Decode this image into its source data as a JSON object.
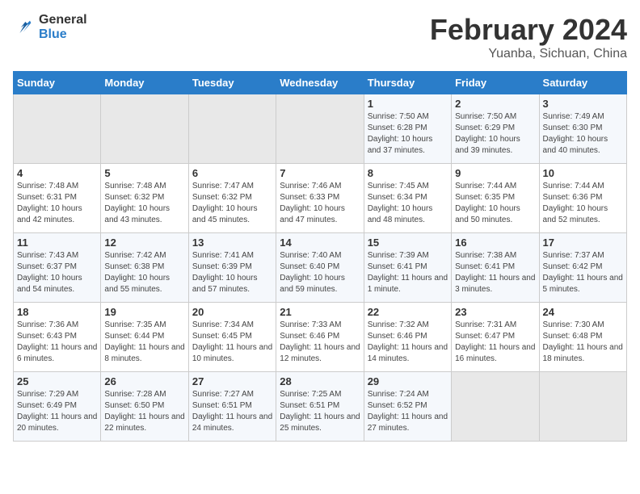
{
  "header": {
    "logo_line1": "General",
    "logo_line2": "Blue",
    "month_title": "February 2024",
    "subtitle": "Yuanba, Sichuan, China"
  },
  "weekdays": [
    "Sunday",
    "Monday",
    "Tuesday",
    "Wednesday",
    "Thursday",
    "Friday",
    "Saturday"
  ],
  "weeks": [
    [
      {
        "day": "",
        "empty": true
      },
      {
        "day": "",
        "empty": true
      },
      {
        "day": "",
        "empty": true
      },
      {
        "day": "",
        "empty": true
      },
      {
        "day": "1",
        "sunrise": "Sunrise: 7:50 AM",
        "sunset": "Sunset: 6:28 PM",
        "daylight": "Daylight: 10 hours and 37 minutes."
      },
      {
        "day": "2",
        "sunrise": "Sunrise: 7:50 AM",
        "sunset": "Sunset: 6:29 PM",
        "daylight": "Daylight: 10 hours and 39 minutes."
      },
      {
        "day": "3",
        "sunrise": "Sunrise: 7:49 AM",
        "sunset": "Sunset: 6:30 PM",
        "daylight": "Daylight: 10 hours and 40 minutes."
      }
    ],
    [
      {
        "day": "4",
        "sunrise": "Sunrise: 7:48 AM",
        "sunset": "Sunset: 6:31 PM",
        "daylight": "Daylight: 10 hours and 42 minutes."
      },
      {
        "day": "5",
        "sunrise": "Sunrise: 7:48 AM",
        "sunset": "Sunset: 6:32 PM",
        "daylight": "Daylight: 10 hours and 43 minutes."
      },
      {
        "day": "6",
        "sunrise": "Sunrise: 7:47 AM",
        "sunset": "Sunset: 6:32 PM",
        "daylight": "Daylight: 10 hours and 45 minutes."
      },
      {
        "day": "7",
        "sunrise": "Sunrise: 7:46 AM",
        "sunset": "Sunset: 6:33 PM",
        "daylight": "Daylight: 10 hours and 47 minutes."
      },
      {
        "day": "8",
        "sunrise": "Sunrise: 7:45 AM",
        "sunset": "Sunset: 6:34 PM",
        "daylight": "Daylight: 10 hours and 48 minutes."
      },
      {
        "day": "9",
        "sunrise": "Sunrise: 7:44 AM",
        "sunset": "Sunset: 6:35 PM",
        "daylight": "Daylight: 10 hours and 50 minutes."
      },
      {
        "day": "10",
        "sunrise": "Sunrise: 7:44 AM",
        "sunset": "Sunset: 6:36 PM",
        "daylight": "Daylight: 10 hours and 52 minutes."
      }
    ],
    [
      {
        "day": "11",
        "sunrise": "Sunrise: 7:43 AM",
        "sunset": "Sunset: 6:37 PM",
        "daylight": "Daylight: 10 hours and 54 minutes."
      },
      {
        "day": "12",
        "sunrise": "Sunrise: 7:42 AM",
        "sunset": "Sunset: 6:38 PM",
        "daylight": "Daylight: 10 hours and 55 minutes."
      },
      {
        "day": "13",
        "sunrise": "Sunrise: 7:41 AM",
        "sunset": "Sunset: 6:39 PM",
        "daylight": "Daylight: 10 hours and 57 minutes."
      },
      {
        "day": "14",
        "sunrise": "Sunrise: 7:40 AM",
        "sunset": "Sunset: 6:40 PM",
        "daylight": "Daylight: 10 hours and 59 minutes."
      },
      {
        "day": "15",
        "sunrise": "Sunrise: 7:39 AM",
        "sunset": "Sunset: 6:41 PM",
        "daylight": "Daylight: 11 hours and 1 minute."
      },
      {
        "day": "16",
        "sunrise": "Sunrise: 7:38 AM",
        "sunset": "Sunset: 6:41 PM",
        "daylight": "Daylight: 11 hours and 3 minutes."
      },
      {
        "day": "17",
        "sunrise": "Sunrise: 7:37 AM",
        "sunset": "Sunset: 6:42 PM",
        "daylight": "Daylight: 11 hours and 5 minutes."
      }
    ],
    [
      {
        "day": "18",
        "sunrise": "Sunrise: 7:36 AM",
        "sunset": "Sunset: 6:43 PM",
        "daylight": "Daylight: 11 hours and 6 minutes."
      },
      {
        "day": "19",
        "sunrise": "Sunrise: 7:35 AM",
        "sunset": "Sunset: 6:44 PM",
        "daylight": "Daylight: 11 hours and 8 minutes."
      },
      {
        "day": "20",
        "sunrise": "Sunrise: 7:34 AM",
        "sunset": "Sunset: 6:45 PM",
        "daylight": "Daylight: 11 hours and 10 minutes."
      },
      {
        "day": "21",
        "sunrise": "Sunrise: 7:33 AM",
        "sunset": "Sunset: 6:46 PM",
        "daylight": "Daylight: 11 hours and 12 minutes."
      },
      {
        "day": "22",
        "sunrise": "Sunrise: 7:32 AM",
        "sunset": "Sunset: 6:46 PM",
        "daylight": "Daylight: 11 hours and 14 minutes."
      },
      {
        "day": "23",
        "sunrise": "Sunrise: 7:31 AM",
        "sunset": "Sunset: 6:47 PM",
        "daylight": "Daylight: 11 hours and 16 minutes."
      },
      {
        "day": "24",
        "sunrise": "Sunrise: 7:30 AM",
        "sunset": "Sunset: 6:48 PM",
        "daylight": "Daylight: 11 hours and 18 minutes."
      }
    ],
    [
      {
        "day": "25",
        "sunrise": "Sunrise: 7:29 AM",
        "sunset": "Sunset: 6:49 PM",
        "daylight": "Daylight: 11 hours and 20 minutes."
      },
      {
        "day": "26",
        "sunrise": "Sunrise: 7:28 AM",
        "sunset": "Sunset: 6:50 PM",
        "daylight": "Daylight: 11 hours and 22 minutes."
      },
      {
        "day": "27",
        "sunrise": "Sunrise: 7:27 AM",
        "sunset": "Sunset: 6:51 PM",
        "daylight": "Daylight: 11 hours and 24 minutes."
      },
      {
        "day": "28",
        "sunrise": "Sunrise: 7:25 AM",
        "sunset": "Sunset: 6:51 PM",
        "daylight": "Daylight: 11 hours and 25 minutes."
      },
      {
        "day": "29",
        "sunrise": "Sunrise: 7:24 AM",
        "sunset": "Sunset: 6:52 PM",
        "daylight": "Daylight: 11 hours and 27 minutes."
      },
      {
        "day": "",
        "empty": true
      },
      {
        "day": "",
        "empty": true
      }
    ]
  ]
}
